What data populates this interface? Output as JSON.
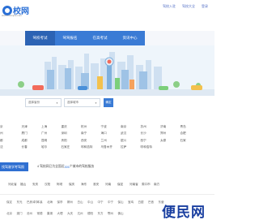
{
  "header": {
    "logo_text": "校网",
    "logo_sub": "www.example.com",
    "top_links": [
      "驾校入驻",
      "驾校大全",
      "登录"
    ]
  },
  "nav": {
    "items": [
      "驾校考试",
      "驾驾报名",
      "在高考试",
      "资讯中心"
    ]
  },
  "search": {
    "select1": "选择省份",
    "select2": "选择城市",
    "button": "确定"
  },
  "cities": [
    [
      "京",
      "天津",
      "上海",
      "重庆",
      "杭州",
      "宁波",
      "南京",
      "苏州",
      "济南",
      "青岛"
    ],
    [
      "州",
      "厦门",
      "广州",
      "深圳",
      "南宁",
      "海口",
      "武汉",
      "长沙",
      "郑州",
      "合肥"
    ],
    [
      "都",
      "成都",
      "昆明",
      "贵阳",
      "西安",
      "兰州",
      "银川",
      "西宁",
      "太原",
      "石家"
    ],
    [
      "沈",
      "长春",
      "哈尔",
      "石家庄",
      "呼和浩特",
      "乌鲁木齐",
      "拉萨",
      "呼和浩特",
      "",
      ""
    ]
  ],
  "info": {
    "tag": "找驾驶学考驾照",
    "text_prefix": "4 驾校网已为全国近",
    "text_highlight": "300",
    "text_suffix": "个城市的驾校服务"
  },
  "provinces": [
    "河北省",
    "福山",
    "安庆",
    "汉阳",
    "阿坝",
    "保庆",
    "海东",
    "淮安",
    "河南",
    "保定",
    "河南省",
    "周口市",
    "南方"
  ],
  "footer": {
    "links": [
      "保定",
      "东光",
      "巴彦淖尔",
      "本溪",
      "北海",
      "保亭",
      "郴州",
      "白山",
      "中山",
      "中宁",
      "中宁",
      "保山",
      "宝鸡",
      "白银",
      "巴音",
      "东营",
      "北京",
      "澳门",
      "沧州",
      "常德",
      "巢湖",
      "大理",
      "大庆",
      "达州",
      "德阳",
      "东方",
      "鄂州",
      "佛山"
    ],
    "watermark": "便民网"
  },
  "colors": {
    "brand": "#2a6fd6",
    "nav_bg": "#3a7bd5",
    "nav_active": "#2c63b4",
    "watermark": "#1a3fa0"
  }
}
